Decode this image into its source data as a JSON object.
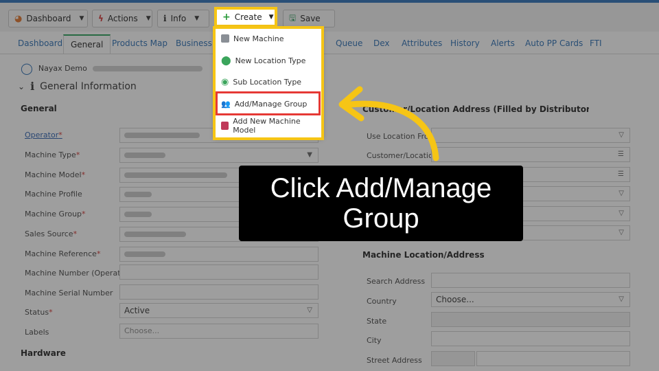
{
  "toolbar": {
    "dashboard_label": "Dashboard",
    "actions_label": "Actions",
    "info_label": "Info",
    "create_label": "Create",
    "save_label": "Save"
  },
  "tabs": [
    "Dashboard",
    "General",
    "Products Map",
    "Business d",
    "Queue",
    "Dex",
    "Attributes",
    "History",
    "Alerts",
    "Auto PP Cards",
    "FTI"
  ],
  "breadcrumb": {
    "label": "Nayax Demo"
  },
  "section": {
    "title": "General Information"
  },
  "left_form": {
    "title": "General",
    "fields": [
      {
        "label": "Operator",
        "required": "*",
        "value": ""
      },
      {
        "label": "Machine Type",
        "required": "*",
        "value": ""
      },
      {
        "label": "Machine Model",
        "required": "*",
        "value": ""
      },
      {
        "label": "Machine Profile",
        "required": "",
        "value": ""
      },
      {
        "label": "Machine Group",
        "required": "*",
        "value": ""
      },
      {
        "label": "Sales Source",
        "required": "*",
        "value": ""
      },
      {
        "label": "Machine Reference",
        "required": "*",
        "value": ""
      },
      {
        "label": "Machine Number (Operator)",
        "required": "",
        "value": ""
      },
      {
        "label": "Machine Serial Number",
        "required": "",
        "value": ""
      },
      {
        "label": "Status",
        "required": "*",
        "value": "Active"
      },
      {
        "label": "Labels",
        "required": "",
        "value": "Choose..."
      }
    ],
    "hardware_title": "Hardware"
  },
  "right_form": {
    "address_title": "Customer/Location Address (Filled by Distributor)",
    "address_title_visible": "Customer/Location Address (Filled by Distributor)",
    "use_location_label": "Use Location From",
    "customer_location_label": "Customer/Location",
    "machine_location_title": "Machine Location/Address",
    "search_address_label": "Search Address",
    "country_label": "Country",
    "country_value": "Choose...",
    "state_label": "State",
    "city_label": "City",
    "street_address_label": "Street Address"
  },
  "create_menu": {
    "items": [
      "New Machine",
      "New Location Type",
      "Sub Location Type",
      "Add/Manage Group",
      "Add New Machine Model"
    ]
  },
  "callout": {
    "line1": "Click Add/Manage",
    "line2": "Group"
  },
  "colors": {
    "highlight": "#f6c515",
    "target": "#e53935",
    "link": "#2a6db3",
    "required": "#d0312d"
  }
}
